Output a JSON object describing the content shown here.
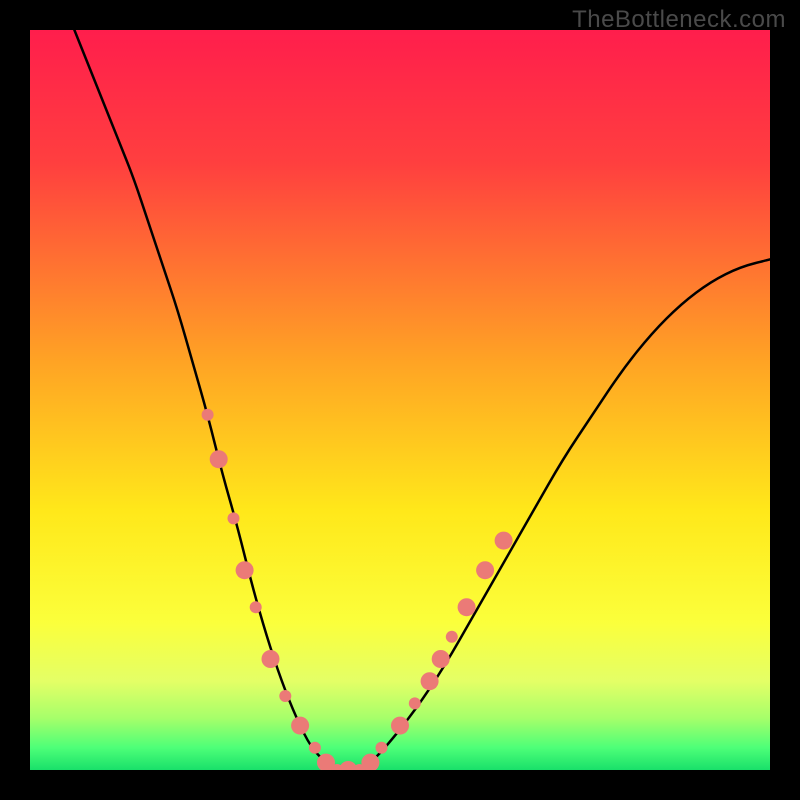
{
  "watermark": "TheBottleneck.com",
  "chart_data": {
    "type": "line",
    "title": "",
    "xlabel": "",
    "ylabel": "",
    "xlim": [
      0,
      100
    ],
    "ylim": [
      0,
      100
    ],
    "gradient_stops": [
      {
        "offset": 0,
        "color": "#ff1e4c"
      },
      {
        "offset": 0.18,
        "color": "#ff3f3f"
      },
      {
        "offset": 0.45,
        "color": "#ffa424"
      },
      {
        "offset": 0.65,
        "color": "#ffe81a"
      },
      {
        "offset": 0.8,
        "color": "#fbff3b"
      },
      {
        "offset": 0.88,
        "color": "#e4ff66"
      },
      {
        "offset": 0.93,
        "color": "#a6ff6a"
      },
      {
        "offset": 0.97,
        "color": "#4dff78"
      },
      {
        "offset": 1.0,
        "color": "#19e06a"
      }
    ],
    "series": [
      {
        "name": "bottleneck-curve",
        "x": [
          6,
          8,
          10,
          12,
          14,
          16,
          18,
          20,
          22,
          24,
          26,
          28,
          30,
          32,
          34,
          36,
          38,
          40,
          42,
          44,
          46,
          48,
          52,
          56,
          60,
          64,
          68,
          72,
          76,
          80,
          84,
          88,
          92,
          96,
          100
        ],
        "y": [
          100,
          95,
          90,
          85,
          80,
          74,
          68,
          62,
          55,
          48,
          40,
          33,
          25,
          18,
          12,
          7,
          3,
          1,
          0,
          0,
          1,
          3,
          8,
          14,
          21,
          28,
          35,
          42,
          48,
          54,
          59,
          63,
          66,
          68,
          69
        ]
      }
    ],
    "markers": [
      {
        "x": 24.0,
        "y": 48,
        "r": 6
      },
      {
        "x": 25.5,
        "y": 42,
        "r": 9
      },
      {
        "x": 27.5,
        "y": 34,
        "r": 6
      },
      {
        "x": 29.0,
        "y": 27,
        "r": 9
      },
      {
        "x": 30.5,
        "y": 22,
        "r": 6
      },
      {
        "x": 32.5,
        "y": 15,
        "r": 9
      },
      {
        "x": 34.5,
        "y": 10,
        "r": 6
      },
      {
        "x": 36.5,
        "y": 6,
        "r": 9
      },
      {
        "x": 38.5,
        "y": 3,
        "r": 6
      },
      {
        "x": 40.0,
        "y": 1,
        "r": 9
      },
      {
        "x": 41.5,
        "y": 0,
        "r": 6
      },
      {
        "x": 43.0,
        "y": 0,
        "r": 9
      },
      {
        "x": 44.5,
        "y": 0,
        "r": 6
      },
      {
        "x": 46.0,
        "y": 1,
        "r": 9
      },
      {
        "x": 47.5,
        "y": 3,
        "r": 6
      },
      {
        "x": 50.0,
        "y": 6,
        "r": 9
      },
      {
        "x": 52.0,
        "y": 9,
        "r": 6
      },
      {
        "x": 54.0,
        "y": 12,
        "r": 9
      },
      {
        "x": 55.5,
        "y": 15,
        "r": 9
      },
      {
        "x": 57.0,
        "y": 18,
        "r": 6
      },
      {
        "x": 59.0,
        "y": 22,
        "r": 9
      },
      {
        "x": 61.5,
        "y": 27,
        "r": 9
      },
      {
        "x": 64.0,
        "y": 31,
        "r": 9
      }
    ],
    "marker_color": "#eb7a77",
    "curve_color": "#000000"
  }
}
